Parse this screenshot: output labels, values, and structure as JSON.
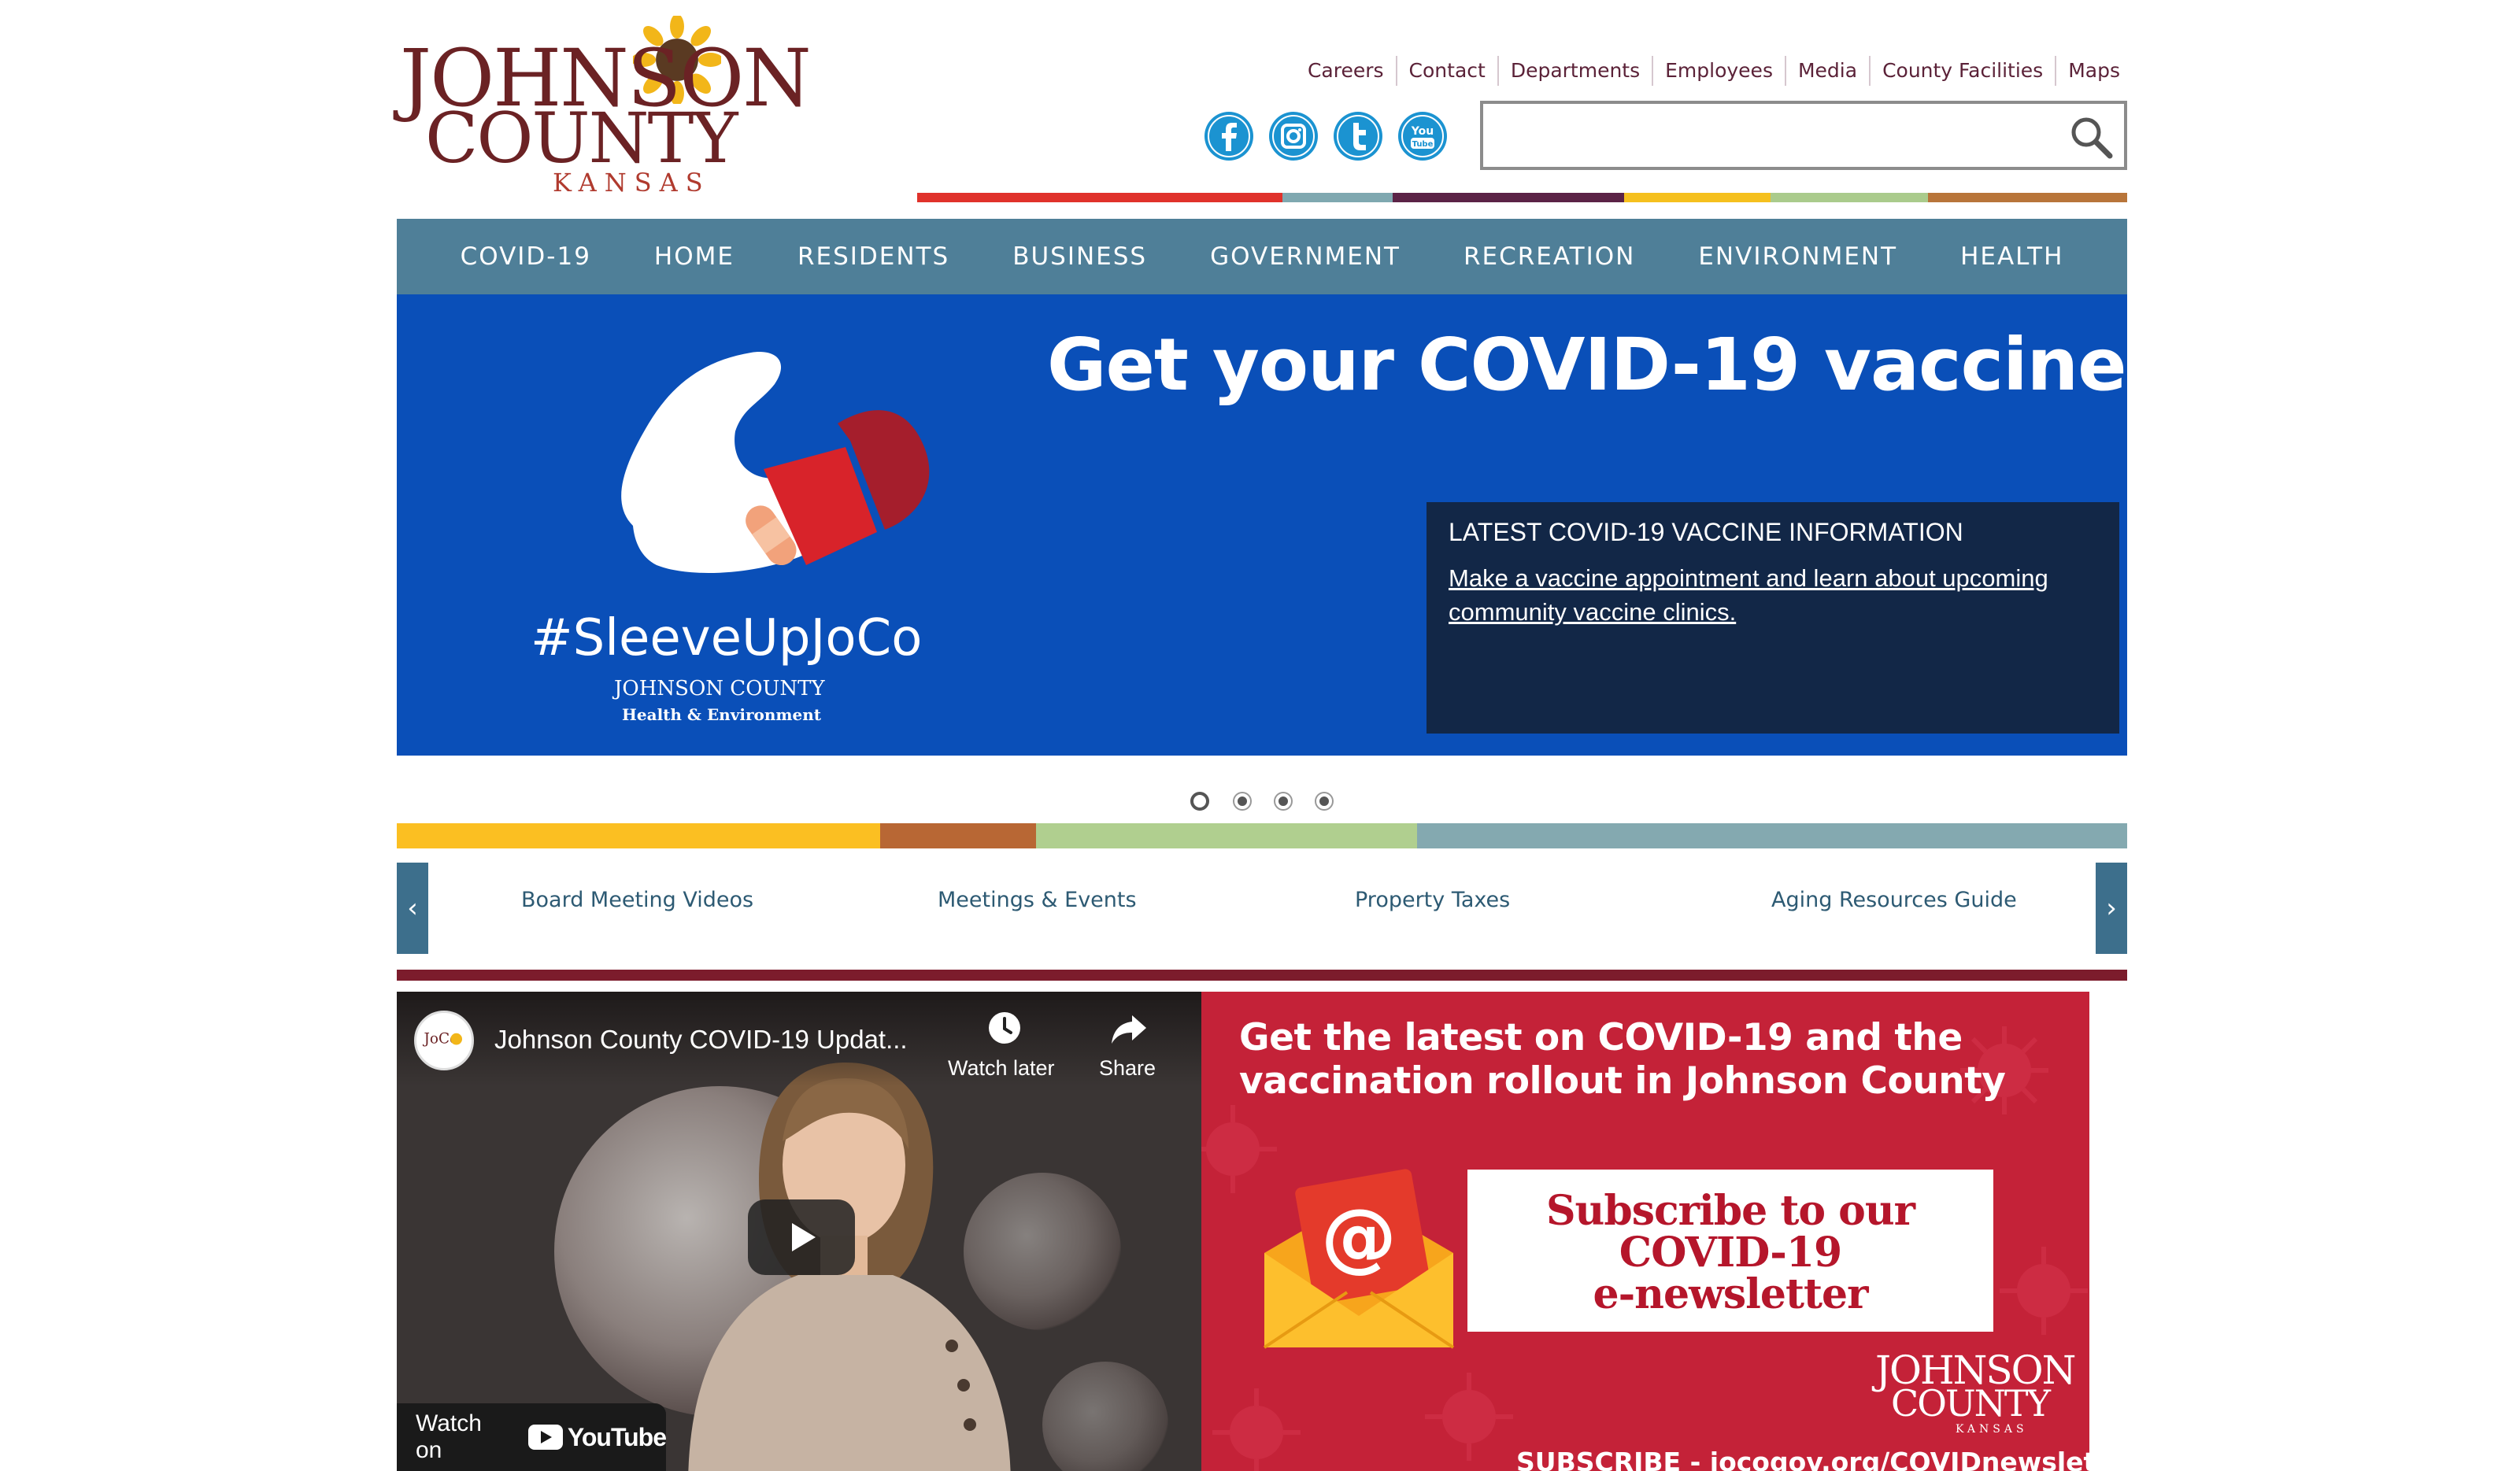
{
  "header": {
    "logo": {
      "line1": "JOHNSON",
      "line2": "COUNTY",
      "line3": "KANSAS"
    },
    "top_links": [
      "Careers",
      "Contact",
      "Departments",
      "Employees",
      "Media",
      "County Facilities",
      "Maps"
    ],
    "social_icons": [
      "facebook-icon",
      "instagram-icon",
      "twitter-icon",
      "youtube-icon"
    ],
    "search": {
      "placeholder": "",
      "value": ""
    }
  },
  "nav": {
    "items": [
      "COVID-19",
      "HOME",
      "RESIDENTS",
      "BUSINESS",
      "GOVERNMENT",
      "RECREATION",
      "ENVIRONMENT",
      "HEALTH"
    ]
  },
  "hero": {
    "headline": "Get your COVID-19 vaccine",
    "hashtag": "#SleeveUpJoCo",
    "logo_text": "JOHNSON COUNTY",
    "logo_sub": "Health & Environment",
    "info_title": "LATEST COVID-19 VACCINE INFORMATION",
    "info_link": "Make a vaccine appointment and learn about upcoming community vaccine clinics.",
    "slide_count": 4,
    "active_slide": 1
  },
  "quick_links": {
    "items": [
      "Board Meeting Videos",
      "Meetings & Events",
      "Property Taxes",
      "Aging Resources Guide"
    ],
    "prev_icon": "chevron-left-icon",
    "next_icon": "chevron-right-icon"
  },
  "video": {
    "channel_logo": "JoCo",
    "title": "Johnson County COVID-19 Updat...",
    "watch_later": "Watch later",
    "share": "Share",
    "watch_on": "Watch on",
    "youtube": "YouTube"
  },
  "promo": {
    "title_line1": "Get the latest on COVID-19 and the",
    "title_line2": "vaccination rollout in Johnson County",
    "card_line1": "Subscribe to our",
    "card_line2": "COVID-19",
    "card_line3": "e-newsletter",
    "footer": "SUBSCRIBE - jocogov.org/COVIDnewsletter",
    "logo_line1": "JOHNSON",
    "logo_line2": "COUNTY",
    "logo_line3": "KANSAS"
  },
  "colors": {
    "nav_bg": "#4f7f98",
    "hero_bg": "#0a4fb8",
    "info_box_bg": "#122747",
    "promo_bg": "#c42238",
    "maroon": "#7c1c2c",
    "brand_text": "#6b2224",
    "top_bar": [
      "#e0322b",
      "#7fa8b0",
      "#5b2346",
      "#f5c01e",
      "#aacb8c",
      "#b8753a"
    ],
    "mid_bar": [
      "#fbbf22",
      "#b86734",
      "#b0cf8f",
      "#84a9b0"
    ]
  }
}
